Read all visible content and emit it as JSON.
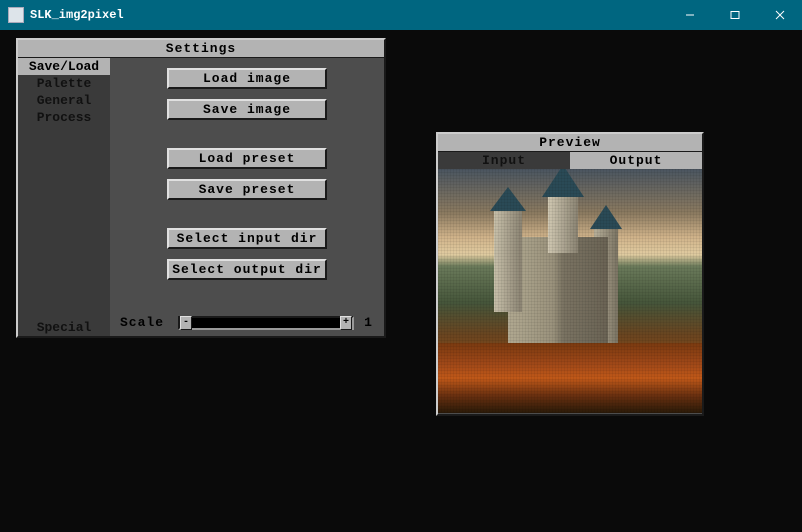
{
  "window": {
    "title": "SLK_img2pixel"
  },
  "settings": {
    "title": "Settings",
    "tabs": {
      "save_load": "Save/Load",
      "palette": "Palette",
      "general": "General",
      "process": "Process",
      "special": "Special"
    },
    "buttons": {
      "load_image": "Load image",
      "save_image": "Save image",
      "load_preset": "Load preset",
      "save_preset": "Save preset",
      "select_input_dir": "Select input dir",
      "select_output_dir": "Select output dir"
    },
    "scale": {
      "label": "Scale",
      "minus": "-",
      "plus": "+",
      "value": "1"
    }
  },
  "preview": {
    "title": "Preview",
    "tab_input": "Input",
    "tab_output": "Output"
  }
}
